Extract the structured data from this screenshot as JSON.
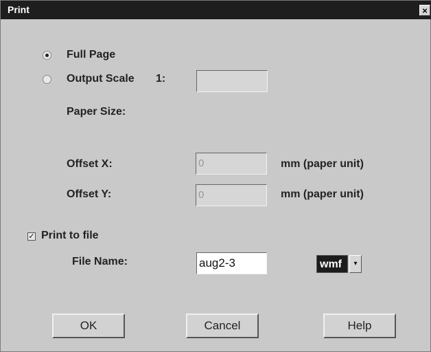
{
  "window": {
    "title": "Print",
    "close_glyph": "×"
  },
  "options": {
    "full_page_label": "Full Page",
    "full_page_selected": true,
    "output_scale_label": "Output Scale",
    "scale_prefix": "1:",
    "output_scale_selected": false,
    "output_scale_value": "",
    "paper_size_label": "Paper Size:"
  },
  "offset": {
    "x_label": "Offset X:",
    "x_value": "0",
    "y_label": "Offset Y:",
    "y_value": "0",
    "unit_label": "mm (paper unit)"
  },
  "print_to_file": {
    "label": "Print to file",
    "checked": true,
    "check_glyph": "✓",
    "file_name_label": "File Name:",
    "file_name_value": "aug2-3",
    "format_value": "wmf",
    "dropdown_glyph": "▾"
  },
  "buttons": {
    "ok": "OK",
    "cancel": "Cancel",
    "help": "Help"
  }
}
